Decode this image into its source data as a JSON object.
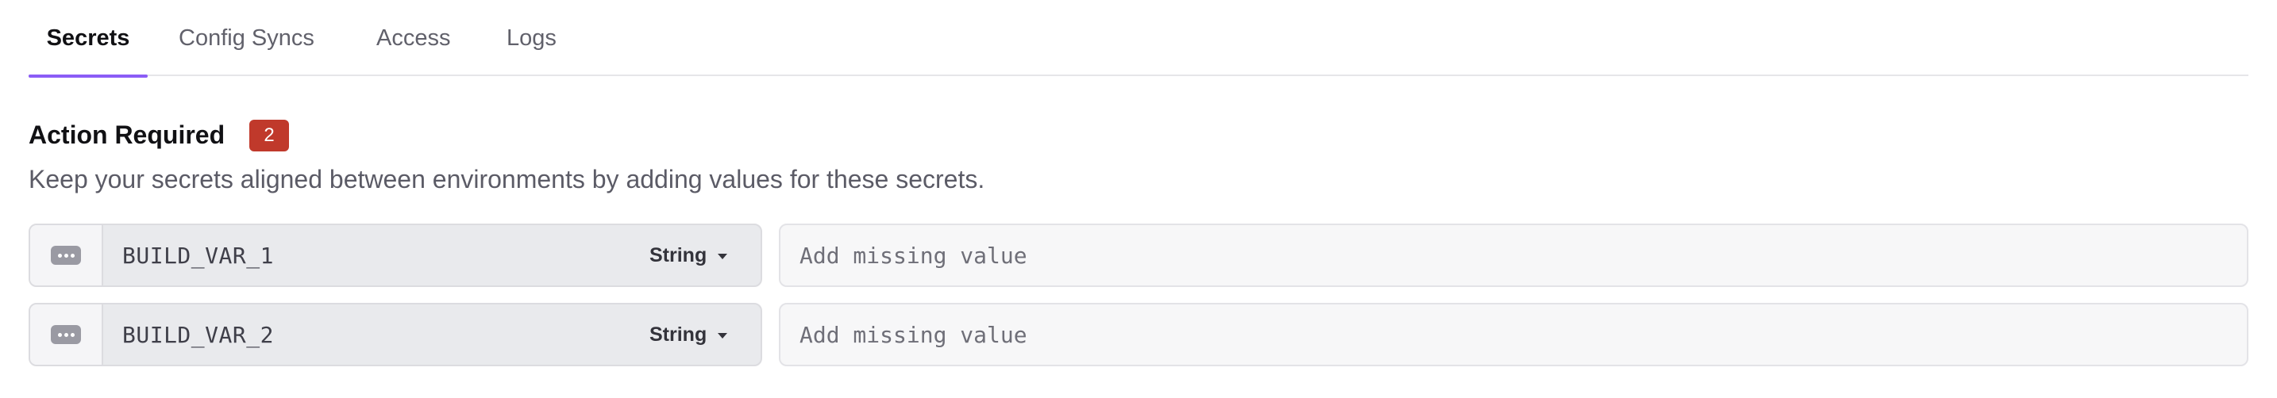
{
  "tabs": [
    {
      "label": "Secrets",
      "active": true
    },
    {
      "label": "Config Syncs",
      "active": false
    },
    {
      "label": "Access",
      "active": false
    },
    {
      "label": "Logs",
      "active": false
    }
  ],
  "section": {
    "title": "Action Required",
    "count_badge": "2",
    "description": "Keep your secrets aligned between environments by adding values for these secrets."
  },
  "secrets": [
    {
      "key": "BUILD_VAR_1",
      "type": "String",
      "value_placeholder": "Add missing value",
      "handle_icon": "dots-horizontal-icon"
    },
    {
      "key": "BUILD_VAR_2",
      "type": "String",
      "value_placeholder": "Add missing value",
      "handle_icon": "dots-horizontal-icon"
    }
  ],
  "colors": {
    "accent": "#8b5cf6",
    "badge": "#c0392b"
  }
}
